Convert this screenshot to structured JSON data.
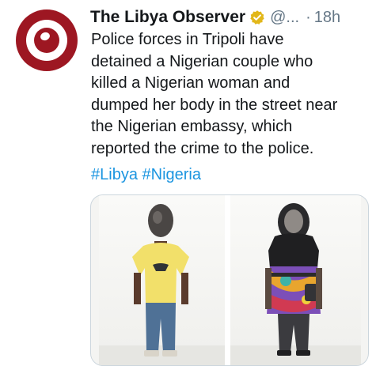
{
  "tweet": {
    "author_name": "The Libya Observer",
    "handle": "@...",
    "separator": "·",
    "time": "18h",
    "text_lines": [
      "Police forces in Tripoli have",
      "detained a Nigerian couple who",
      "killed a Nigerian woman and",
      "dumped her body in the street near",
      "the Nigerian embassy, which",
      "reported the crime to the police."
    ],
    "hashtags": [
      "#Libya",
      "#Nigeria"
    ]
  },
  "colors": {
    "brand": "#9d1722",
    "link": "#1b95e0",
    "verified": "#e2b719",
    "muted": "#657786"
  },
  "icons": {
    "avatar": "libya-observer-logo",
    "verified": "verified-badge-icon"
  }
}
